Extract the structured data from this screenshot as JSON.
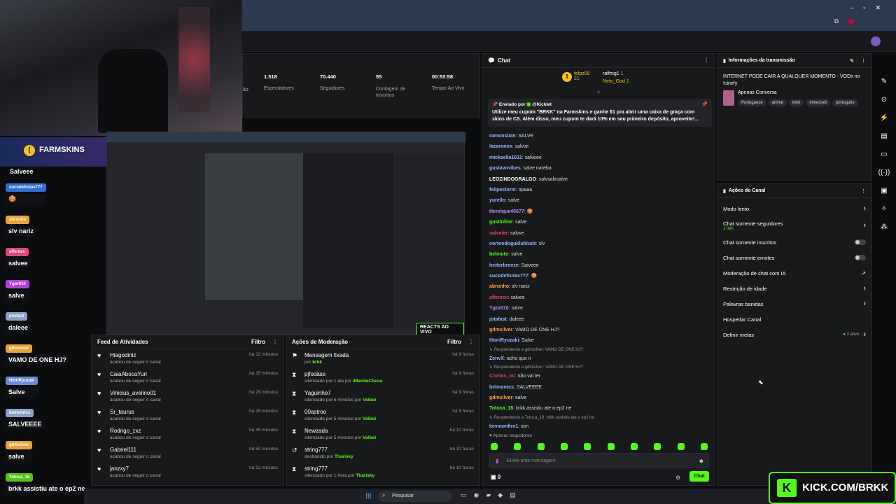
{
  "stats": [
    {
      "value": "1.518",
      "label": "Espectadores"
    },
    {
      "value": "70.440",
      "label": "Seguidores"
    },
    {
      "value": "55",
      "label": "Contagem de Inscritos"
    },
    {
      "value": "00:53:58",
      "label": "Tempo Ao Vivo"
    }
  ],
  "stats_partial_label": "ão",
  "overlay": {
    "brand": "FARMSKINS",
    "first_text": "Salveee",
    "messages": [
      {
        "name": "sucodefrutas777",
        "text": "",
        "color": "#2f6fd6"
      },
      {
        "name": "abrunho",
        "text": "slv nariz",
        "color": "#e8a23a"
      },
      {
        "name": "alferesx",
        "text": "salvee",
        "color": "#e0457a"
      },
      {
        "name": "Ygor010",
        "text": "salve",
        "color": "#b040e0"
      },
      {
        "name": "jotafast",
        "text": "daleee",
        "color": "#8aa0c8"
      },
      {
        "name": "gdmsilver",
        "text": "VAMO DE ONE HJ?",
        "color": "#e8a23a"
      },
      {
        "name": "HioriRyuzaki",
        "text": "Salve",
        "color": "#6a8ad8"
      },
      {
        "name": "belmontcs",
        "text": "SALVEEEE",
        "color": "#8aa0c8"
      },
      {
        "name": "gdmsilver",
        "text": "salve",
        "color": "#e8a23a"
      },
      {
        "name": "Totoca_18",
        "text": "brkk assistiu ate o ep2 ne",
        "color": "#53c418"
      }
    ],
    "kick_banner": "KICK.COM/BRKK",
    "react_label": "REACTS AO VIVO"
  },
  "feed": {
    "title": "Feed de Atividades",
    "filter": "Filtro",
    "items": [
      {
        "name": "Hiagodiniz",
        "sub": "acabou de seguir o canal",
        "time": "há 12 minutos"
      },
      {
        "name": "CaiaAbocaYuri",
        "sub": "acabou de seguir o canal",
        "time": "há 15 minutos"
      },
      {
        "name": "Vinicius_avelino01",
        "sub": "acabou de seguir o canal",
        "time": "há 29 minutos"
      },
      {
        "name": "Sr_taurus",
        "sub": "acabou de seguir o canal",
        "time": "há 29 minutos"
      },
      {
        "name": "Rodrigo_zxz",
        "sub": "acabou de seguir o canal",
        "time": "há 45 minutos"
      },
      {
        "name": "Gabriel111",
        "sub": "acabou de seguir o canal",
        "time": "há 50 minutos"
      },
      {
        "name": "janzxy7",
        "sub": "acabou de seguir o canal",
        "time": "há 52 minutos"
      }
    ]
  },
  "mod": {
    "title": "Ações de Moderação",
    "filter": "Filtro",
    "items": [
      {
        "name": "Mensagem fixada",
        "sub": "por ",
        "by": "brkk",
        "time": "há 9 horas",
        "icon": "pin"
      },
      {
        "name": "pjfodase",
        "sub": "silenciado por 1 dia por ",
        "by": "iMandaChuva",
        "time": "há 9 horas",
        "icon": "hourglass"
      },
      {
        "name": "Yaguinho7",
        "sub": "silenciado por 5 minutos por ",
        "by": "Volbei",
        "time": "há 9 horas",
        "icon": "hourglass"
      },
      {
        "name": "00astroo",
        "sub": "silenciado por 5 minutos por ",
        "by": "Volbei",
        "time": "há 9 horas",
        "icon": "hourglass"
      },
      {
        "name": "Newzada",
        "sub": "silenciado por 5 minutos por ",
        "by": "Volbei",
        "time": "há 10 horas",
        "icon": "hourglass"
      },
      {
        "name": "string777",
        "sub": "desbanido por ",
        "by": "Tharisky",
        "time": "há 10 horas",
        "icon": "undo"
      },
      {
        "name": "string777",
        "sub": "silenciado por 1 hora por ",
        "by": "Tharisky",
        "time": "há 10 horas",
        "icon": "hourglass"
      }
    ]
  },
  "chat": {
    "title": "Chat",
    "top_gifters": [
      {
        "name": "felpz09",
        "count": "21"
      },
      {
        "name": "raffmg1",
        "count": "1"
      },
      {
        "name": "Neto_God",
        "count": "1"
      }
    ],
    "pinned_by_label": "Enviado por",
    "pinned_by": "@Kicklet",
    "pinned_text": "Utilize meu cupom \"BRKK\" na Farmskins e ganhe $1 pra abrir uma caixa de graça com skins de CS. Além disso, meu cupom te dará 10% em seu primeiro depósito, aproveite!...",
    "messages": [
      {
        "user": "ramonslate",
        "color": "#8fb8ff",
        "text": "SALVE"
      },
      {
        "user": "lazaronox",
        "color": "#8fb8ff",
        "text": "salvve"
      },
      {
        "user": "mickaella1611",
        "color": "#8fb8ff",
        "text": "salveee"
      },
      {
        "user": "gustavovibes",
        "color": "#8fb8ff",
        "text": "salve nareba"
      },
      {
        "user": "LEOZINDOGRALGO",
        "color": "#ffffff",
        "text": "salvsalvsalve"
      },
      {
        "user": "felipestorm",
        "color": "#8fb8ff",
        "text": "opaaa"
      },
      {
        "user": "yurello",
        "color": "#8fb8ff",
        "text": "salve"
      },
      {
        "user": "Henrique45677",
        "color": "#b48cff",
        "text": "🍪"
      },
      {
        "user": "gustinline",
        "color": "#53fc18",
        "text": "salve"
      },
      {
        "user": "salvelar",
        "color": "#e0457a",
        "text": "salvve"
      },
      {
        "user": "corteodoguklubluck",
        "color": "#8fb8ff",
        "text": "slv"
      },
      {
        "user": "belmuto",
        "color": "#53fc18",
        "text": "salve"
      },
      {
        "user": "heitorbreeze",
        "color": "#8fb8ff",
        "text": "Saiveee"
      },
      {
        "user": "sucodefrutas777",
        "color": "#8fb8ff",
        "text": "🍪"
      },
      {
        "user": "abrunho",
        "color": "#ffa040",
        "text": "slv nariz"
      },
      {
        "user": "alferesx",
        "color": "#e0457a",
        "text": "salvee"
      },
      {
        "user": "Ygor010",
        "color": "#b48cff",
        "text": "salve"
      },
      {
        "user": "jotafast",
        "color": "#8fb8ff",
        "text": "daleee"
      },
      {
        "user": "gdmsilver",
        "color": "#ffa040",
        "text": "VAMO DE ONE HJ?"
      },
      {
        "user": "HioriRyuzaki",
        "color": "#8fb8ff",
        "text": "Salve"
      },
      {
        "user": "ZenvX",
        "color": "#8fb8ff",
        "text": "acho que n",
        "reply": "Respondendo a gdmsilver: VAMO DE ONE HJ?"
      },
      {
        "user": "Cronos_nc",
        "color": "#e0457a",
        "text": "não vai ter",
        "reply": "Respondendo a gdmsilver: VAMO DE ONE HJ?"
      },
      {
        "user": "belmontcs",
        "color": "#8fb8ff",
        "text": "SALVEEEE"
      },
      {
        "user": "gdmsilver",
        "color": "#ffa040",
        "text": "salve"
      },
      {
        "user": "Totoca_18",
        "color": "#53fc18",
        "text": "brkk assistiu ate o ep2 ne"
      },
      {
        "user": "kevinonfire1",
        "color": "#8fb8ff",
        "text": "sim",
        "reply": "Respondendo a Totoca_18: brkk assistiu ate o ep2 ne"
      }
    ],
    "followers_only": "Apenas seguidores",
    "input_placeholder": "Envie uma mensagem",
    "count": "0",
    "send_label": "Chat"
  },
  "stream_info": {
    "title": "Informações da transmissão",
    "stream_title": "INTERNET PODE CAIR A QUALQUER MOMENTO - VODs no !cinefy",
    "category": "Apenas Conversa",
    "tags": [
      "Portuguese",
      "anime",
      "brkk",
      "minecraft",
      "português"
    ]
  },
  "actions": {
    "title": "Ações do Canal",
    "items": [
      {
        "label": "Modo lento",
        "type": "chev"
      },
      {
        "label": "Chat somente seguidores",
        "sub": "1 min",
        "type": "chev"
      },
      {
        "label": "Chat somente inscritos",
        "type": "toggle"
      },
      {
        "label": "Chat somente emotes",
        "type": "toggle"
      },
      {
        "label": "Moderação de chat com IA",
        "type": "ext"
      },
      {
        "label": "Restrição de idade",
        "type": "chev"
      },
      {
        "label": "Palavras banidas",
        "type": "chev"
      },
      {
        "label": "Hospedar Canal",
        "type": "none"
      },
      {
        "label": "Definir metas",
        "sub": "2 ativo",
        "type": "chev"
      }
    ]
  },
  "taskbar": {
    "search": "Pesquisar"
  },
  "colors": {
    "accent": "#53fc18",
    "panel": "#18191b",
    "bg": "#0b0c0e"
  }
}
